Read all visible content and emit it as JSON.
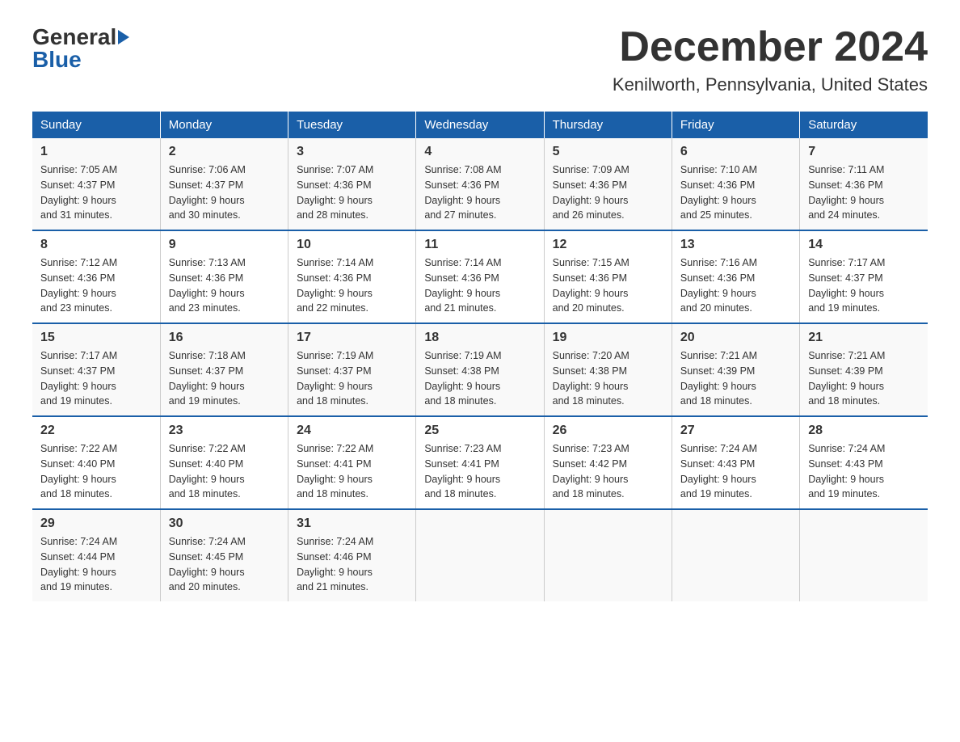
{
  "logo": {
    "general": "General",
    "blue": "Blue"
  },
  "header": {
    "month": "December 2024",
    "location": "Kenilworth, Pennsylvania, United States"
  },
  "days_of_week": [
    "Sunday",
    "Monday",
    "Tuesday",
    "Wednesday",
    "Thursday",
    "Friday",
    "Saturday"
  ],
  "weeks": [
    [
      {
        "day": "1",
        "sunrise": "7:05 AM",
        "sunset": "4:37 PM",
        "daylight": "9 hours and 31 minutes."
      },
      {
        "day": "2",
        "sunrise": "7:06 AM",
        "sunset": "4:37 PM",
        "daylight": "9 hours and 30 minutes."
      },
      {
        "day": "3",
        "sunrise": "7:07 AM",
        "sunset": "4:36 PM",
        "daylight": "9 hours and 28 minutes."
      },
      {
        "day": "4",
        "sunrise": "7:08 AM",
        "sunset": "4:36 PM",
        "daylight": "9 hours and 27 minutes."
      },
      {
        "day": "5",
        "sunrise": "7:09 AM",
        "sunset": "4:36 PM",
        "daylight": "9 hours and 26 minutes."
      },
      {
        "day": "6",
        "sunrise": "7:10 AM",
        "sunset": "4:36 PM",
        "daylight": "9 hours and 25 minutes."
      },
      {
        "day": "7",
        "sunrise": "7:11 AM",
        "sunset": "4:36 PM",
        "daylight": "9 hours and 24 minutes."
      }
    ],
    [
      {
        "day": "8",
        "sunrise": "7:12 AM",
        "sunset": "4:36 PM",
        "daylight": "9 hours and 23 minutes."
      },
      {
        "day": "9",
        "sunrise": "7:13 AM",
        "sunset": "4:36 PM",
        "daylight": "9 hours and 23 minutes."
      },
      {
        "day": "10",
        "sunrise": "7:14 AM",
        "sunset": "4:36 PM",
        "daylight": "9 hours and 22 minutes."
      },
      {
        "day": "11",
        "sunrise": "7:14 AM",
        "sunset": "4:36 PM",
        "daylight": "9 hours and 21 minutes."
      },
      {
        "day": "12",
        "sunrise": "7:15 AM",
        "sunset": "4:36 PM",
        "daylight": "9 hours and 20 minutes."
      },
      {
        "day": "13",
        "sunrise": "7:16 AM",
        "sunset": "4:36 PM",
        "daylight": "9 hours and 20 minutes."
      },
      {
        "day": "14",
        "sunrise": "7:17 AM",
        "sunset": "4:37 PM",
        "daylight": "9 hours and 19 minutes."
      }
    ],
    [
      {
        "day": "15",
        "sunrise": "7:17 AM",
        "sunset": "4:37 PM",
        "daylight": "9 hours and 19 minutes."
      },
      {
        "day": "16",
        "sunrise": "7:18 AM",
        "sunset": "4:37 PM",
        "daylight": "9 hours and 19 minutes."
      },
      {
        "day": "17",
        "sunrise": "7:19 AM",
        "sunset": "4:37 PM",
        "daylight": "9 hours and 18 minutes."
      },
      {
        "day": "18",
        "sunrise": "7:19 AM",
        "sunset": "4:38 PM",
        "daylight": "9 hours and 18 minutes."
      },
      {
        "day": "19",
        "sunrise": "7:20 AM",
        "sunset": "4:38 PM",
        "daylight": "9 hours and 18 minutes."
      },
      {
        "day": "20",
        "sunrise": "7:21 AM",
        "sunset": "4:39 PM",
        "daylight": "9 hours and 18 minutes."
      },
      {
        "day": "21",
        "sunrise": "7:21 AM",
        "sunset": "4:39 PM",
        "daylight": "9 hours and 18 minutes."
      }
    ],
    [
      {
        "day": "22",
        "sunrise": "7:22 AM",
        "sunset": "4:40 PM",
        "daylight": "9 hours and 18 minutes."
      },
      {
        "day": "23",
        "sunrise": "7:22 AM",
        "sunset": "4:40 PM",
        "daylight": "9 hours and 18 minutes."
      },
      {
        "day": "24",
        "sunrise": "7:22 AM",
        "sunset": "4:41 PM",
        "daylight": "9 hours and 18 minutes."
      },
      {
        "day": "25",
        "sunrise": "7:23 AM",
        "sunset": "4:41 PM",
        "daylight": "9 hours and 18 minutes."
      },
      {
        "day": "26",
        "sunrise": "7:23 AM",
        "sunset": "4:42 PM",
        "daylight": "9 hours and 18 minutes."
      },
      {
        "day": "27",
        "sunrise": "7:24 AM",
        "sunset": "4:43 PM",
        "daylight": "9 hours and 19 minutes."
      },
      {
        "day": "28",
        "sunrise": "7:24 AM",
        "sunset": "4:43 PM",
        "daylight": "9 hours and 19 minutes."
      }
    ],
    [
      {
        "day": "29",
        "sunrise": "7:24 AM",
        "sunset": "4:44 PM",
        "daylight": "9 hours and 19 minutes."
      },
      {
        "day": "30",
        "sunrise": "7:24 AM",
        "sunset": "4:45 PM",
        "daylight": "9 hours and 20 minutes."
      },
      {
        "day": "31",
        "sunrise": "7:24 AM",
        "sunset": "4:46 PM",
        "daylight": "9 hours and 21 minutes."
      },
      null,
      null,
      null,
      null
    ]
  ],
  "labels": {
    "sunrise": "Sunrise:",
    "sunset": "Sunset:",
    "daylight": "Daylight:"
  }
}
